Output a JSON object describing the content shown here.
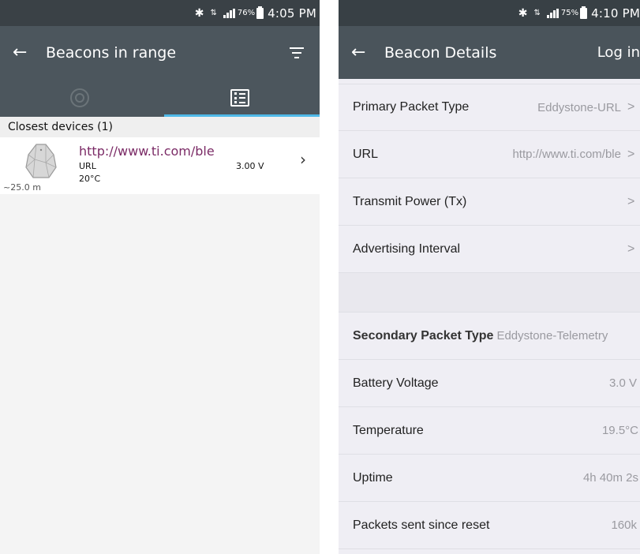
{
  "left": {
    "status": {
      "battery": "76%",
      "time": "4:05 PM"
    },
    "toolbar": {
      "title": "Beacons in range"
    },
    "section": {
      "header": "Closest devices (1)"
    },
    "device": {
      "url": "http://www.ti.com/ble",
      "type": "URL",
      "voltage": "3.00 V",
      "temperature": "20°C",
      "distance": "~25.0 m"
    },
    "tabs": [
      {
        "icon": "radar-icon",
        "selected": false
      },
      {
        "icon": "list-icon",
        "selected": true
      }
    ]
  },
  "right": {
    "status": {
      "battery": "75%",
      "time": "4:10 PM"
    },
    "toolbar": {
      "title": "Beacon Details",
      "action": "Log in"
    },
    "rows": [
      {
        "label": "Primary Packet Type",
        "value": "Eddystone-URL",
        "chevron": ">"
      },
      {
        "label": "URL",
        "value": "http://www.ti.com/ble",
        "chevron": ">"
      },
      {
        "label": "Transmit Power (Tx)",
        "value": "",
        "chevron": ">"
      },
      {
        "label": "Advertising Interval",
        "value": "",
        "chevron": ">"
      }
    ],
    "rows2": [
      {
        "label": "Secondary Packet Type",
        "value": "Eddystone-Telemetry"
      },
      {
        "label": "Battery Voltage",
        "value": "3.0 V"
      },
      {
        "label": "Temperature",
        "value": "19.5°C"
      },
      {
        "label": "Uptime",
        "value": "4h 40m 2s"
      },
      {
        "label": "Packets sent since reset",
        "value": "160k"
      }
    ]
  },
  "colors": {
    "statusbar": "#3a4146",
    "toolbar": "#4c565d",
    "accent": "#4fb9e8",
    "link": "#7b2b66"
  }
}
